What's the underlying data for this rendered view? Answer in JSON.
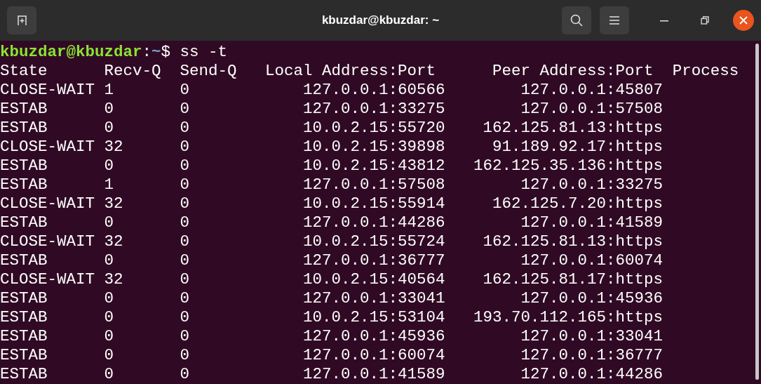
{
  "window": {
    "title": "kbuzdar@kbuzdar: ~"
  },
  "prompt": {
    "user_host": "kbuzdar@kbuzdar",
    "separator": ":",
    "path": "~",
    "symbol": "$",
    "command": "ss -t"
  },
  "table": {
    "columns": [
      "State",
      "Recv-Q",
      "Send-Q",
      "Local Address:Port",
      "Peer Address:Port",
      "Process"
    ],
    "rows": [
      [
        "CLOSE-WAIT",
        "1",
        "0",
        "127.0.0.1:60566",
        "127.0.0.1:45807"
      ],
      [
        "ESTAB",
        "0",
        "0",
        "127.0.0.1:33275",
        "127.0.0.1:57508"
      ],
      [
        "ESTAB",
        "0",
        "0",
        "10.0.2.15:55720",
        "162.125.81.13:https"
      ],
      [
        "CLOSE-WAIT",
        "32",
        "0",
        "10.0.2.15:39898",
        "91.189.92.17:https"
      ],
      [
        "ESTAB",
        "0",
        "0",
        "10.0.2.15:43812",
        "162.125.35.136:https"
      ],
      [
        "ESTAB",
        "1",
        "0",
        "127.0.0.1:57508",
        "127.0.0.1:33275"
      ],
      [
        "CLOSE-WAIT",
        "32",
        "0",
        "10.0.2.15:55914",
        "162.125.7.20:https"
      ],
      [
        "ESTAB",
        "0",
        "0",
        "127.0.0.1:44286",
        "127.0.0.1:41589"
      ],
      [
        "CLOSE-WAIT",
        "32",
        "0",
        "10.0.2.15:55724",
        "162.125.81.13:https"
      ],
      [
        "ESTAB",
        "0",
        "0",
        "127.0.0.1:36777",
        "127.0.0.1:60074"
      ],
      [
        "CLOSE-WAIT",
        "32",
        "0",
        "10.0.2.15:40564",
        "162.125.81.17:https"
      ],
      [
        "ESTAB",
        "0",
        "0",
        "127.0.0.1:33041",
        "127.0.0.1:45936"
      ],
      [
        "ESTAB",
        "0",
        "0",
        "10.0.2.15:53104",
        "193.70.112.165:https"
      ],
      [
        "ESTAB",
        "0",
        "0",
        "127.0.0.1:45936",
        "127.0.0.1:33041"
      ],
      [
        "ESTAB",
        "0",
        "0",
        "127.0.0.1:60074",
        "127.0.0.1:36777"
      ],
      [
        "ESTAB",
        "0",
        "0",
        "127.0.0.1:41589",
        "127.0.0.1:44286"
      ]
    ]
  }
}
